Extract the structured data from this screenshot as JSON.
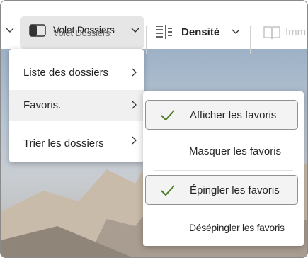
{
  "ribbon": {
    "folder_pane_label": "Volet Dossiers",
    "folder_pane_ghost": "Volet Dossiers",
    "density_label": "Densité",
    "immersive_label": "Imm"
  },
  "menu_folders": {
    "items": [
      {
        "label": "Liste des dossiers"
      },
      {
        "label": "Favoris."
      },
      {
        "label": "Trier les dossiers"
      }
    ]
  },
  "menu_favorites": {
    "items": [
      {
        "label": "Afficher les favoris",
        "checked": true
      },
      {
        "label": "Masquer les favoris",
        "checked": false
      },
      {
        "label": "Épingler les favoris",
        "checked": true
      },
      {
        "label": "Désépingler les favoris",
        "checked": false
      }
    ]
  },
  "colors": {
    "check": "#4e7a27",
    "highlight": "#f0f0f0",
    "ribbon_selected": "#e6e6e6"
  }
}
